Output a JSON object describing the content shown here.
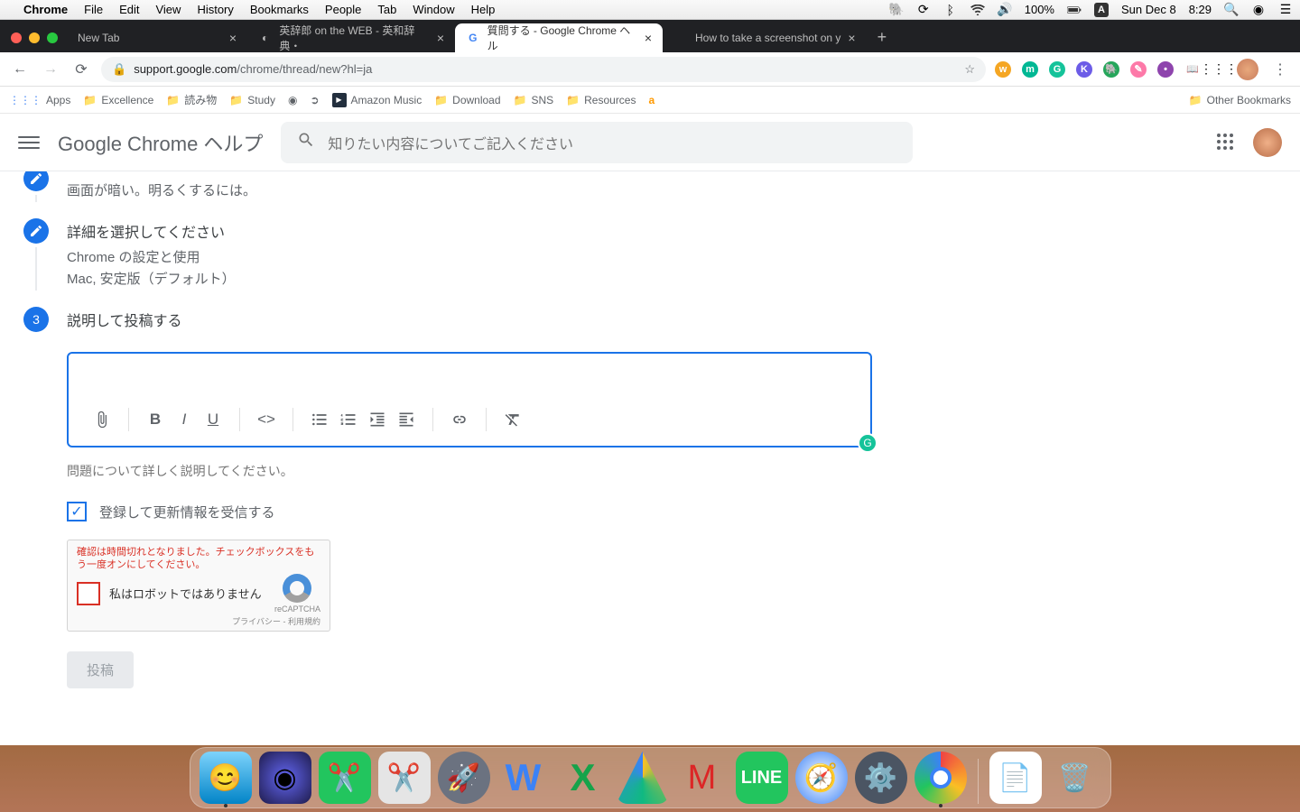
{
  "menubar": {
    "app": "Chrome",
    "items": [
      "File",
      "Edit",
      "View",
      "History",
      "Bookmarks",
      "People",
      "Tab",
      "Window",
      "Help"
    ],
    "battery": "100%",
    "date": "Sun Dec 8",
    "time": "8:29",
    "input_badge": "A"
  },
  "tabs": [
    {
      "title": "New Tab",
      "fav": "",
      "active": false
    },
    {
      "title": "英辞郎 on the WEB - 英和辞典・",
      "fav": "●",
      "active": false
    },
    {
      "title": "質問する - Google Chrome ヘル",
      "fav": "G",
      "active": true
    },
    {
      "title": "How to take a screenshot on y",
      "fav": "",
      "active": false
    }
  ],
  "omnibox": {
    "lock": "🔒",
    "domain": "support.google.com",
    "path": "/chrome/thread/new?hl=ja"
  },
  "extensions": [
    {
      "bg": "#f5a623",
      "t": "w"
    },
    {
      "bg": "#00b894",
      "t": "m"
    },
    {
      "bg": "#15c39a",
      "t": "G"
    },
    {
      "bg": "#6c5ce7",
      "t": "K"
    },
    {
      "bg": "#26a65b",
      "t": "🐘"
    },
    {
      "bg": "#ff7675",
      "t": "✎"
    },
    {
      "bg": "#8e44ad",
      "t": "●"
    },
    {
      "bg": "#d35400",
      "t": "📖"
    }
  ],
  "bookmarks": {
    "apps": "Apps",
    "items": [
      "Excellence",
      "読み物",
      "Study"
    ],
    "mid_icons": [
      "◉",
      "➲"
    ],
    "amazon": "Amazon Music",
    "more": [
      "Download",
      "SNS",
      "Resources"
    ],
    "other": "Other Bookmarks"
  },
  "help": {
    "title": "Google Chrome ヘルプ",
    "search_placeholder": "知りたい内容についてご記入ください"
  },
  "steps": {
    "s1_sub": "画面が暗い。明るくするには。",
    "s2_title": "詳細を選択してください",
    "s2_sub1": "Chrome の設定と使用",
    "s2_sub2": "Mac, 安定版（デフォルト）",
    "s3_num": "3",
    "s3_title": "説明して投稿する"
  },
  "editor": {
    "helper": "問題について詳しく説明してください。"
  },
  "subscribe": "登録して更新情報を受信する",
  "recaptcha": {
    "error": "確認は時間切れとなりました。チェックボックスをもう一度オンにしてください。",
    "label": "私はロボットではありません",
    "brand": "reCAPTCHA",
    "footer": "プライバシー - 利用規約"
  },
  "submit": "投稿"
}
